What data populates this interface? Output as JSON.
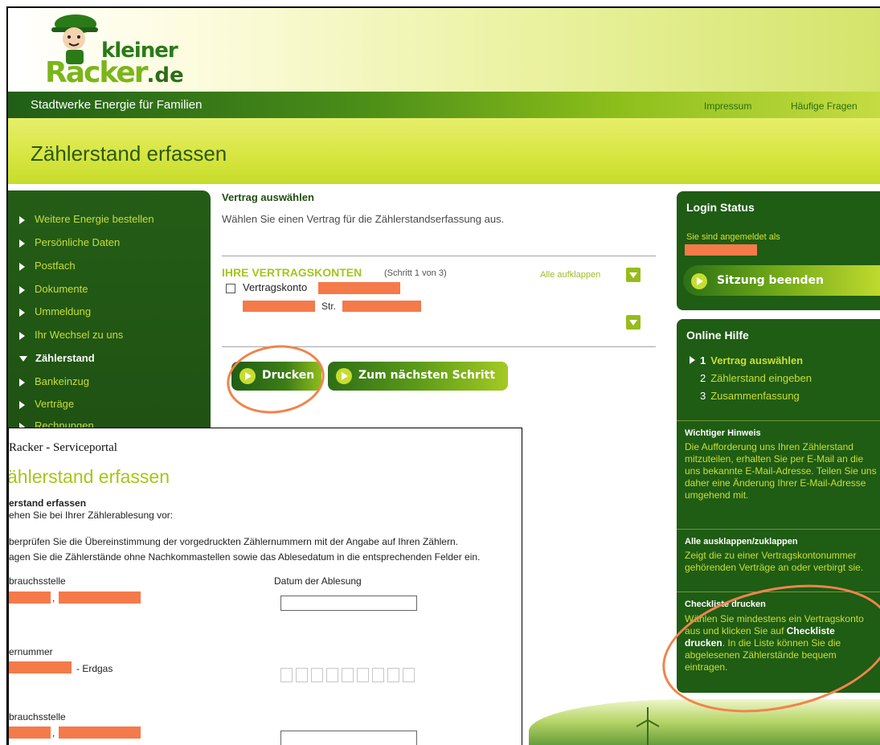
{
  "logo": {
    "top_text": "kleiner",
    "bottom_text": "Racker",
    "bottom_suffix": ".de"
  },
  "brand_bar": {
    "title": "Stadtwerke Energie für Familien",
    "links": [
      "Impressum",
      "Häufige Fragen"
    ]
  },
  "page": {
    "title": "Zählerstand erfassen"
  },
  "nav": {
    "items": [
      {
        "label": "Weitere Energie bestellen",
        "active": false
      },
      {
        "label": "Persönliche Daten",
        "active": false
      },
      {
        "label": "Postfach",
        "active": false
      },
      {
        "label": "Dokumente",
        "active": false
      },
      {
        "label": "Ummeldung",
        "active": false
      },
      {
        "label": "Ihr Wechsel zu uns",
        "active": false
      },
      {
        "label": "Zählerstand",
        "active": true
      },
      {
        "label": "Bankeinzug",
        "active": false
      },
      {
        "label": "Verträge",
        "active": false
      },
      {
        "label": "Rechnungen",
        "active": false
      }
    ]
  },
  "main": {
    "section_heading": "Vertrag auswählen",
    "section_text": "Wählen Sie einen Vertrag für die Zählerstandserfassung aus.",
    "accounts": {
      "title": "IHRE VERTRAGSKONTEN",
      "step": "(Schritt 1 von 3)",
      "expand_all": "Alle aufklappen",
      "account_label": "Vertragskonto",
      "street_label": "Str."
    },
    "buttons": {
      "print": "Drucken",
      "next": "Zum nächsten Schritt"
    }
  },
  "sidebar": {
    "login": {
      "title": "Login Status",
      "text": "Sie sind angemeldet als",
      "logout": "Sitzung beenden"
    },
    "help": {
      "title": "Online Hilfe",
      "steps": [
        {
          "num": "1",
          "label": "Vertrag auswählen",
          "active": true
        },
        {
          "num": "2",
          "label": "Zählerstand eingeben",
          "active": false
        },
        {
          "num": "3",
          "label": "Zusammenfassung",
          "active": false
        }
      ],
      "sections": [
        {
          "heading": "Wichtiger Hinweis",
          "text": "Die Aufforderung uns Ihren Zählerstand mitzuteilen, erhalten Sie per E-Mail an die uns bekannte E-Mail-Adresse. Teilen Sie uns daher eine Änderung Ihrer E-Mail-Adresse umgehend mit."
        },
        {
          "heading": "Alle ausklappen/zuklappen",
          "text": "Zeigt die zu einer Vertragskontonummer gehörenden Verträge an oder verbirgt sie."
        },
        {
          "heading": "Checkliste drucken",
          "text_before": "Wählen Sie mindestens ein Vertragskonto aus und klicken Sie auf",
          "text_bold": "Checkliste drucken",
          "text_after": ". In die Liste können Sie die abgelesenen Zählerstände bequem eintragen."
        }
      ]
    }
  },
  "popup": {
    "window_title": "Racker - Serviceportal",
    "heading": "ählerstand erfassen",
    "sub_heading": "erstand erfassen",
    "intro": "ehen Sie bei Ihrer Zählerablesung vor:",
    "instruction_1": "berprüfen Sie die Übereinstimmung der vorgedruckten Zählernummern mit der Angabe auf Ihren Zählern.",
    "instruction_2": "agen Sie die Zählerstände ohne Nachkommastellen sowie das Ablesedatum in die entsprechenden Felder ein.",
    "field_label_1": "brauchsstelle",
    "date_label": "Datum der Ablesung",
    "comma": ",",
    "meter_label": "ernummer",
    "meter_type": "- Erdgas",
    "field_label_2": "brauchsstelle"
  },
  "colors": {
    "dark_green": "#1f5c14",
    "lime": "#c9df32",
    "redaction": "#f47a4a",
    "annotation": "#f0844c"
  }
}
